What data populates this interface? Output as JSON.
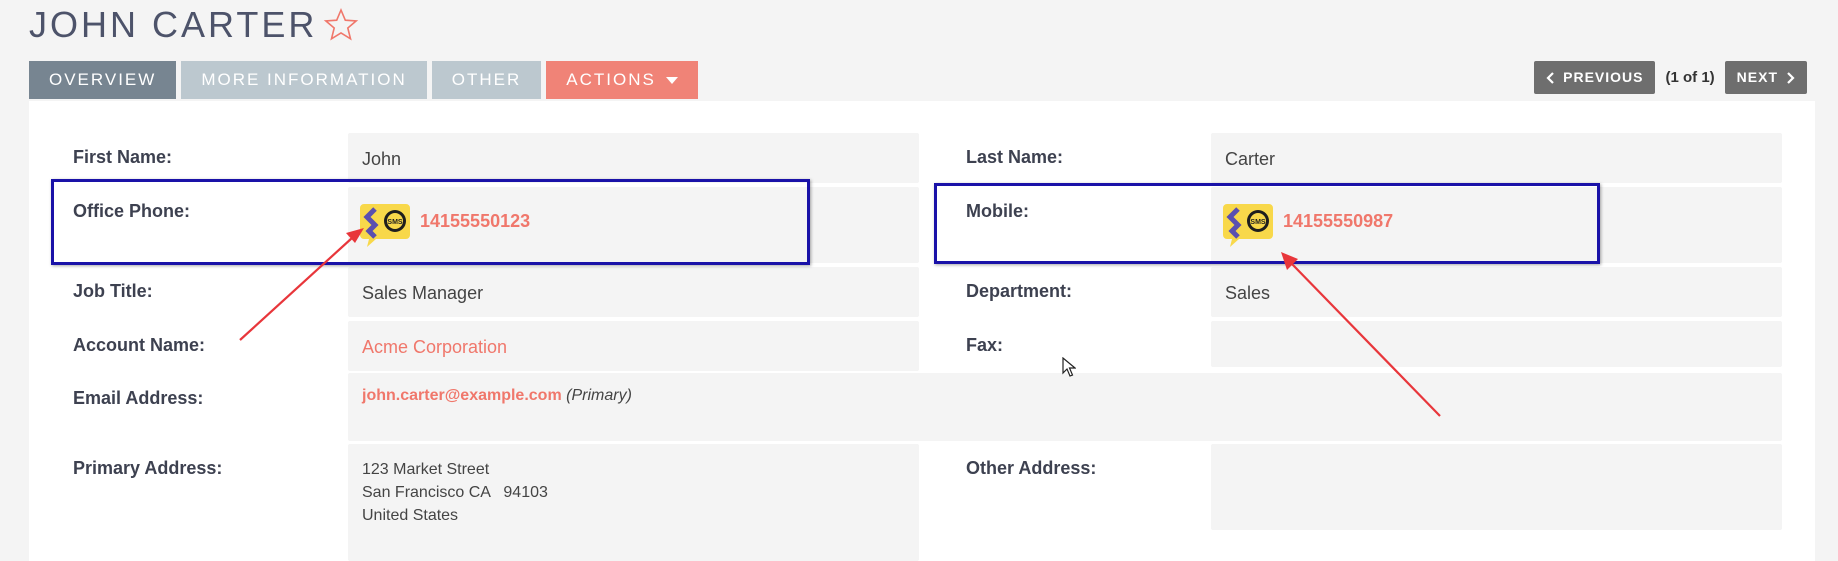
{
  "page": {
    "title": "JOHN CARTER"
  },
  "tabs": [
    {
      "label": "OVERVIEW"
    },
    {
      "label": "MORE INFORMATION"
    },
    {
      "label": "OTHER"
    },
    {
      "label": "ACTIONS"
    }
  ],
  "pager": {
    "previous": "PREVIOUS",
    "count": "(1 of 1)",
    "next": "NEXT"
  },
  "fields": {
    "first_name": {
      "label": "First Name:",
      "value": "John"
    },
    "last_name": {
      "label": "Last Name:",
      "value": "Carter"
    },
    "office_phone": {
      "label": "Office Phone:",
      "value": "14155550123"
    },
    "mobile": {
      "label": "Mobile:",
      "value": "14155550987"
    },
    "job_title": {
      "label": "Job Title:",
      "value": "Sales Manager"
    },
    "department": {
      "label": "Department:",
      "value": "Sales"
    },
    "account_name": {
      "label": "Account Name:",
      "value": "Acme Corporation"
    },
    "fax": {
      "label": "Fax:",
      "value": ""
    },
    "email": {
      "label": "Email Address:",
      "value": "john.carter@example.com",
      "note": "(Primary)"
    },
    "primary_address": {
      "label": "Primary Address:",
      "line1": "123 Market Street",
      "line2": "San Francisco CA   94103",
      "line3": "United States"
    },
    "other_address": {
      "label": "Other Address:",
      "value": ""
    }
  },
  "sms_icon": {
    "text": "SMS"
  },
  "colors": {
    "accent": "#f0776b",
    "tab_active": "#778591",
    "tab_inactive": "#bcc8cf",
    "highlight_box": "#1a12a8",
    "arrow": "#e8363b"
  }
}
